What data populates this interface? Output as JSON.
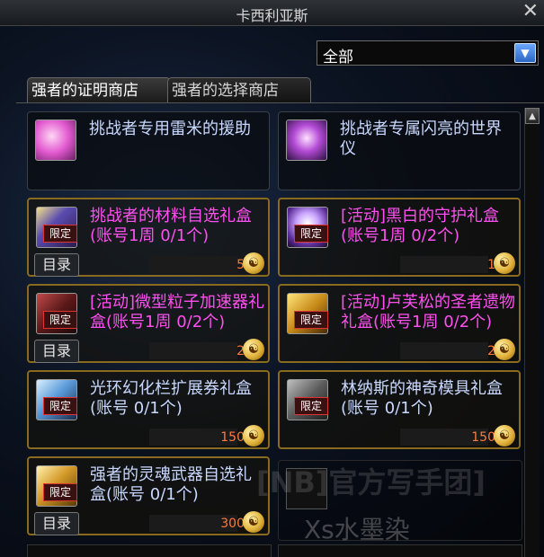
{
  "window": {
    "title": "卡西利亚斯",
    "close_glyph": "✕"
  },
  "filter": {
    "value": "全部",
    "arrow_glyph": "▼"
  },
  "tabs": {
    "proof_shop": "强者的证明商店",
    "choice_shop": "强者的选择商店"
  },
  "scroll": {
    "up_glyph": "▲"
  },
  "common": {
    "badge": "限定",
    "catalog": "目录",
    "coin_glyph": "☯"
  },
  "colors": {
    "pink_name": "#ff4ff0",
    "white_name": "#c8d8ff",
    "price": "#ff7a3a",
    "gold_border": "#8a6a1e"
  },
  "items": [
    {
      "name": "挑战者专用雷米的援助",
      "icon": "pink-orb-icon"
    },
    {
      "name": "挑战者专属闪亮的世界仪",
      "icon": "glowing-globe-icon"
    },
    {
      "name": "挑战者的材料自选礼盒(账号1周 0/1个)",
      "price": "5",
      "icon": "material-box-icon"
    },
    {
      "name": "[活动]黑白的守护礼盒(账号1周 0/2个)",
      "price": "1",
      "icon": "guardian-box-icon"
    },
    {
      "name": "[活动]微型粒子加速器礼盒(账号1周 0/2个)",
      "price": "2",
      "icon": "accelerator-box-icon"
    },
    {
      "name": "[活动]卢芙松的圣者遗物礼盒(账号1周 0/2个)",
      "price": "2",
      "icon": "relic-box-icon"
    },
    {
      "name": "光环幻化栏扩展券礼盒(账号 0/1个)",
      "price": "150",
      "icon": "aura-ticket-icon"
    },
    {
      "name": "林纳斯的神奇模具礼盒(账号 0/1个)",
      "price": "150",
      "icon": "mold-box-icon"
    },
    {
      "name": "强者的灵魂武器自选礼盒(账号 0/1个)",
      "price": "300",
      "icon": "soul-weapon-box-icon"
    }
  ],
  "watermark": {
    "line1": "[NB]官方写手团]",
    "line2": "Xs水墨染"
  }
}
